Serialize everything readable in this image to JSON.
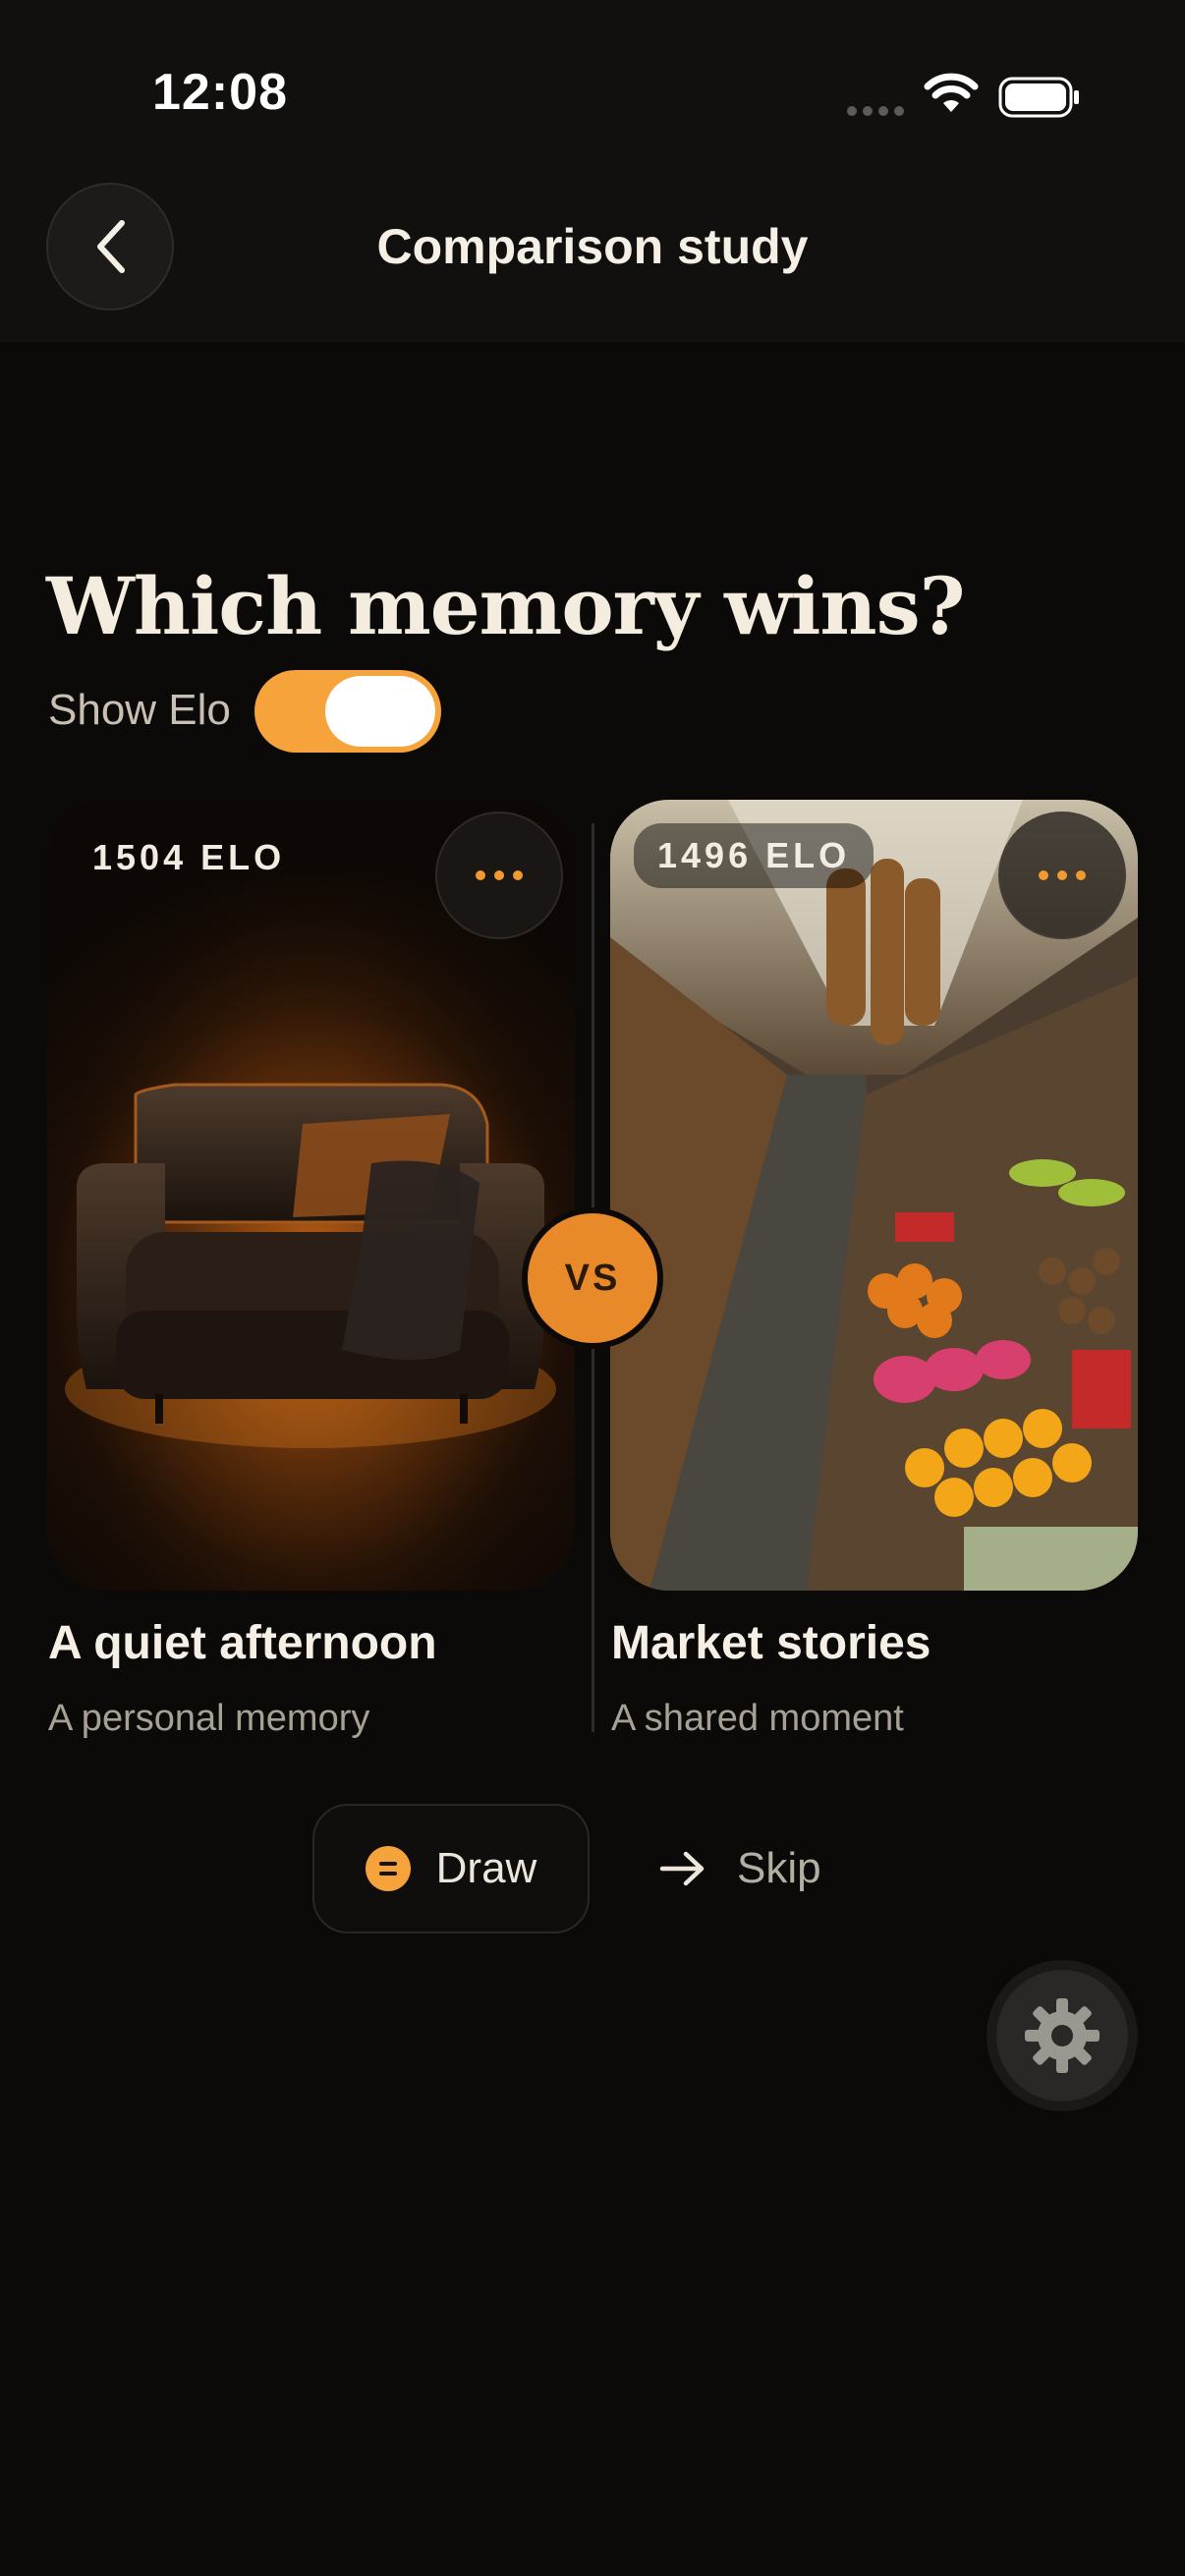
{
  "status_bar": {
    "time": "12:08",
    "wifi_icon": "wifi-icon",
    "battery_icon": "battery-icon"
  },
  "nav": {
    "back_icon": "chevron-left-icon",
    "title": "Comparison study"
  },
  "headline": "Which memory wins?",
  "show_elo": {
    "label": "Show Elo",
    "enabled": true,
    "accent": "#f6a33c"
  },
  "cards": [
    {
      "elo": "1504 ELO",
      "title": "A quiet afternoon",
      "subtitle": "A personal memory",
      "image": "sofa-photo"
    },
    {
      "elo": "1496 ELO",
      "title": "Market stories",
      "subtitle": "A shared moment",
      "image": "market-photo"
    }
  ],
  "vs_label": "VS",
  "actions": {
    "draw": "Draw",
    "skip": "Skip"
  },
  "settings_icon": "gear-icon",
  "colors": {
    "background": "#0b0a09",
    "accent": "#f6a33c",
    "vs": "#e8892a"
  }
}
